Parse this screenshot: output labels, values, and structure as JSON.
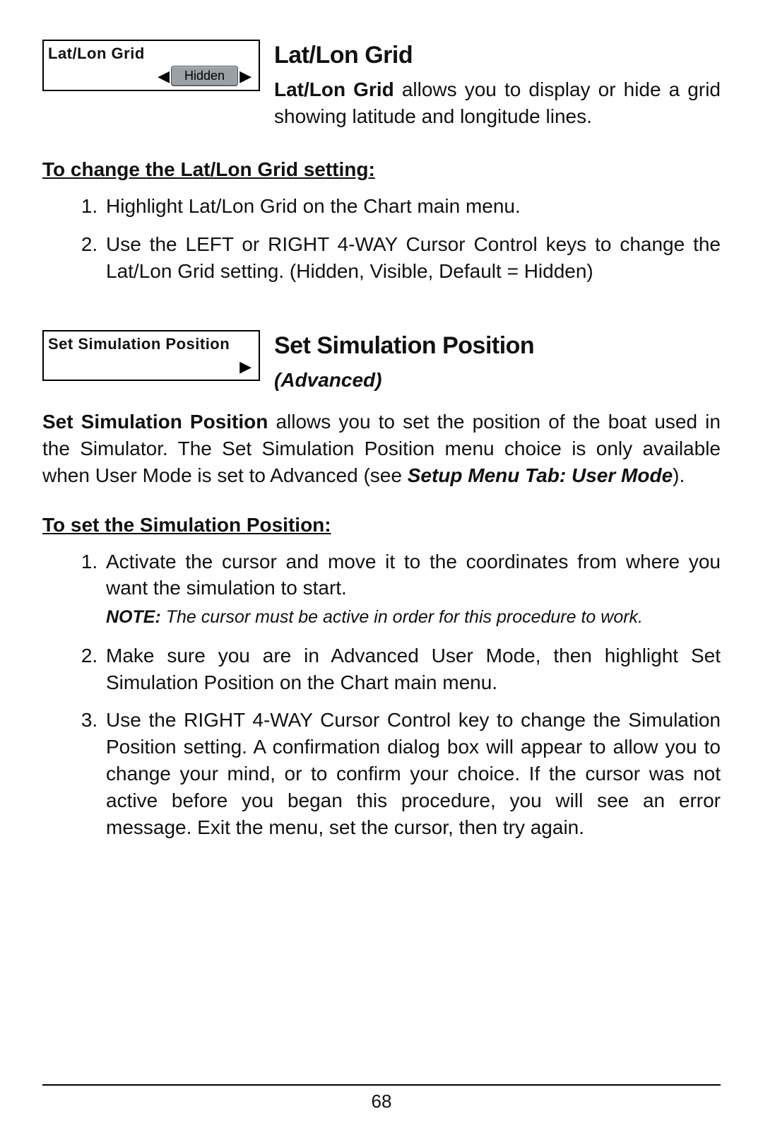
{
  "page_number": "68",
  "section1": {
    "menu": {
      "title": "Lat/Lon Grid",
      "value": "Hidden",
      "left_arrow": "◀",
      "right_arrow": "▶"
    },
    "heading": "Lat/Lon Grid",
    "intro_bold": "Lat/Lon Grid",
    "intro_rest": " allows you to display or hide a grid showing latitude and longitude lines.",
    "subhead": "To change the Lat/Lon Grid setting:",
    "steps": [
      "Highlight Lat/Lon Grid on the Chart main menu.",
      "Use the LEFT or RIGHT 4-WAY Cursor Control keys to change the Lat/Lon Grid setting. (Hidden, Visible, Default = Hidden)"
    ]
  },
  "section2": {
    "menu": {
      "title": "Set Simulation Position",
      "right_arrow": "▶"
    },
    "heading": "Set Simulation Position",
    "subtitle": "(Advanced)",
    "intro_bold": "Set Simulation Position",
    "intro_rest_1": " allows you to set the position of the boat used in the Simulator. The Set Simulation Position menu choice is only available when User Mode is set to Advanced (see ",
    "intro_manual_ref": "Setup Menu Tab: User Mode",
    "intro_rest_2": ").",
    "subhead": "To set the Simulation Position:",
    "steps": [
      "Activate the cursor and move it to the coordinates from where you want the simulation to start.",
      "Make sure you are in Advanced User Mode, then highlight Set Simulation Position on the Chart main menu.",
      "Use the RIGHT 4-WAY Cursor Control key to change the Simulation Position setting.  A confirmation dialog box will appear to allow you to change your mind, or to confirm your choice. If the cursor was not active before you began this procedure, you will see an error message. Exit the menu, set the cursor, then try again."
    ],
    "note_head": "NOTE:",
    "note_body": " The cursor must be active in order for this procedure to work."
  }
}
